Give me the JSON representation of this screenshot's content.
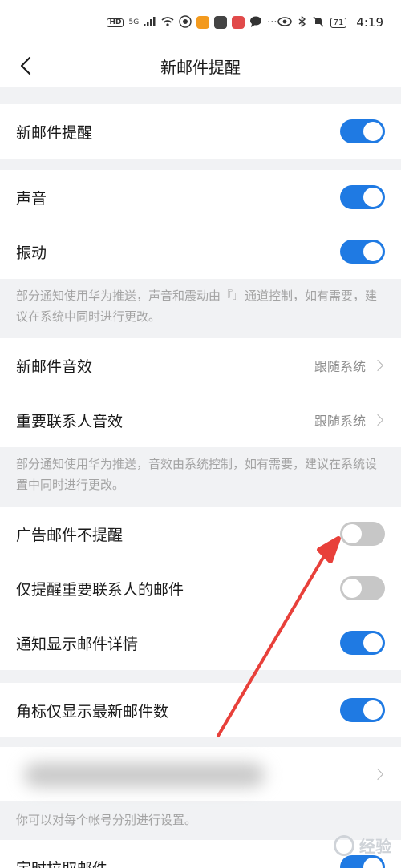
{
  "status_bar": {
    "hd_label": "HD",
    "network_label": "5G",
    "battery_level": "71",
    "time": "4:19",
    "left_icons": [
      "signal-icon",
      "wifi-icon",
      "app-icon-orange",
      "app-icon-red",
      "message-icon",
      "more-dots-icon"
    ],
    "right_icons": [
      "eye-icon",
      "bluetooth-icon",
      "mute-icon",
      "battery-icon"
    ]
  },
  "nav": {
    "title": "新邮件提醒",
    "back_icon": "back-chevron-icon"
  },
  "groups": {
    "main": {
      "label": "新邮件提醒",
      "toggle_on": true
    },
    "sound_vibrate": [
      {
        "label": "声音",
        "toggle_on": true
      },
      {
        "label": "振动",
        "toggle_on": true
      }
    ],
    "sound_note": "部分通知使用华为推送，声音和震动由『』通道控制，如有需要，建议在系统中同时进行更改。",
    "sound_effects": [
      {
        "label": "新邮件音效",
        "value": "跟随系统"
      },
      {
        "label": "重要联系人音效",
        "value": "跟随系统"
      }
    ],
    "effects_note": "部分通知使用华为推送，音效由系统控制，如有需要，建议在系统设置中同时进行更改。",
    "filters": [
      {
        "label": "广告邮件不提醒",
        "toggle_on": false
      },
      {
        "label": "仅提醒重要联系人的邮件",
        "toggle_on": false
      },
      {
        "label": "通知显示邮件详情",
        "toggle_on": true
      }
    ],
    "badge": {
      "label": "角标仅显示最新邮件数",
      "toggle_on": true
    },
    "account_note": "你可以对每个帐号分别进行设置。",
    "fetch": {
      "label": "定时拉取邮件",
      "toggle_on": true
    }
  },
  "colors": {
    "accent": "#1f7ae3",
    "toggle_off": "#c7c7c7",
    "annotation_arrow": "#e8403a"
  },
  "watermark": {
    "text": "经验"
  }
}
